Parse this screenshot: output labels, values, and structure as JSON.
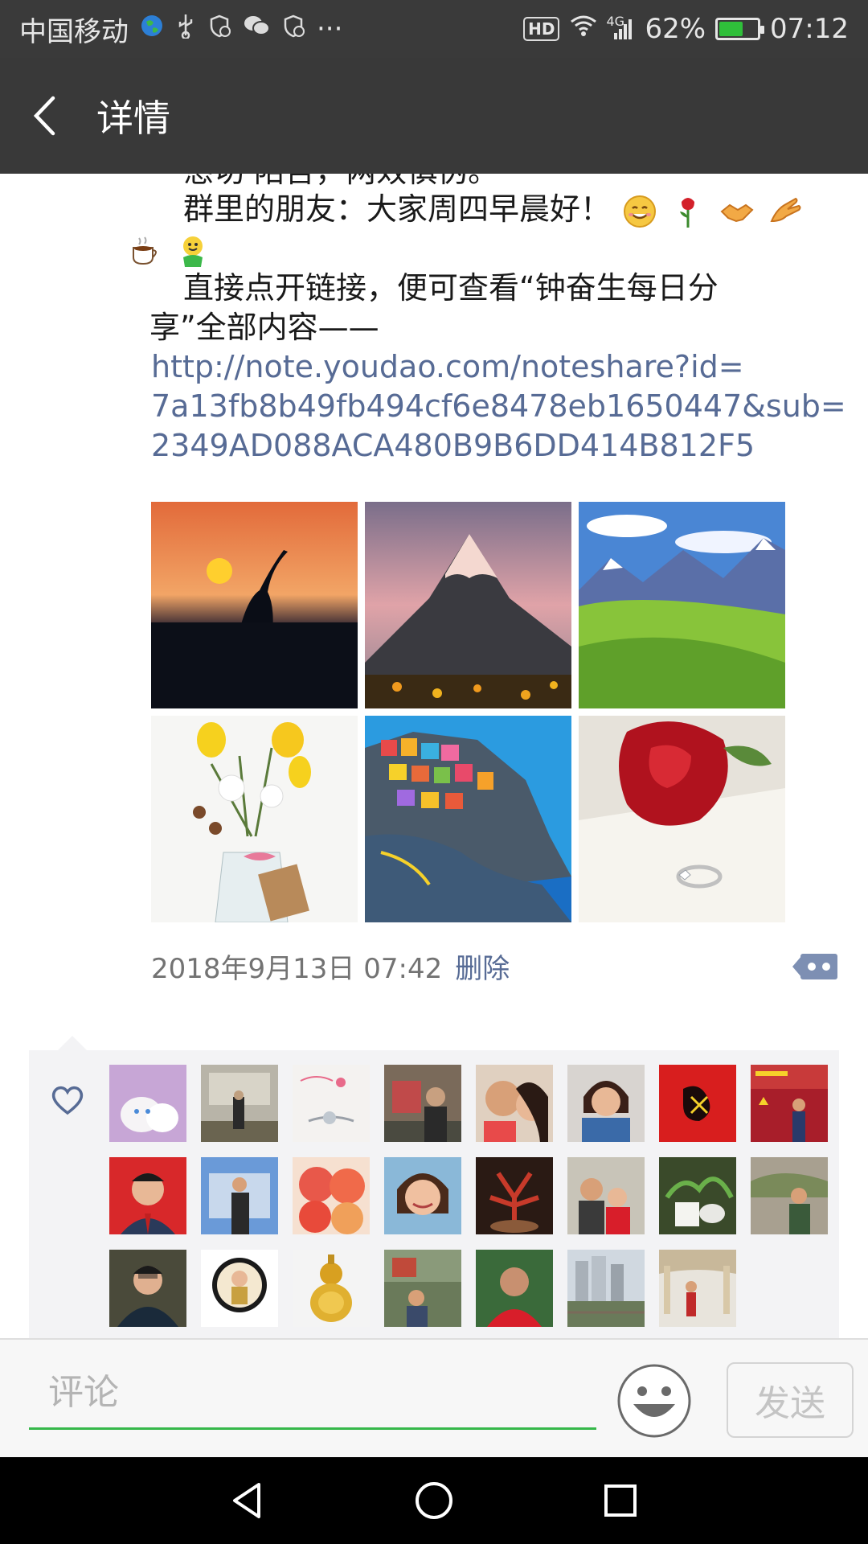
{
  "status_bar": {
    "carrier": "中国移动",
    "network": "4G",
    "battery": "62%",
    "battery_level": 0.62,
    "time": "07:12",
    "hd": "HD",
    "more": "···"
  },
  "header": {
    "title": "详情",
    "back_icon": "back-arrow-icon"
  },
  "post": {
    "cut_line": "恳切 陌哲，两效慎伪。",
    "greeting": "群里的朋友：大家周四早晨好！",
    "instruction_line1": "直接点开链接，便可查看“钟奋生每日分",
    "instruction_line2": "享”全部内容——",
    "link_line1": "http://note.youdao.com/noteshare?id=",
    "link_line2": "7a13fb8b49fb494cf6e8478eb1650447&sub=",
    "link_line3": "2349AD088ACA480B9B6DD414B812F5",
    "photos": [
      "crane-sunset",
      "snow-mountain",
      "green-valley",
      "flower-bouquet",
      "cliff-town",
      "red-rose-ring"
    ],
    "timestamp": "2018年9月13日 07:42",
    "delete_label": "删除"
  },
  "likes": {
    "heart_icon": "heart-outline-icon",
    "avatar_count": 23
  },
  "comment_bar": {
    "placeholder": "评论",
    "send_label": "发送",
    "emoji_icon": "smiley-icon"
  },
  "nav": {
    "back": "nav-back-icon",
    "home": "nav-home-icon",
    "recents": "nav-recents-icon"
  },
  "colors": {
    "link": "#576b95",
    "accent_green": "#36b84a",
    "header_bg": "#393939"
  }
}
